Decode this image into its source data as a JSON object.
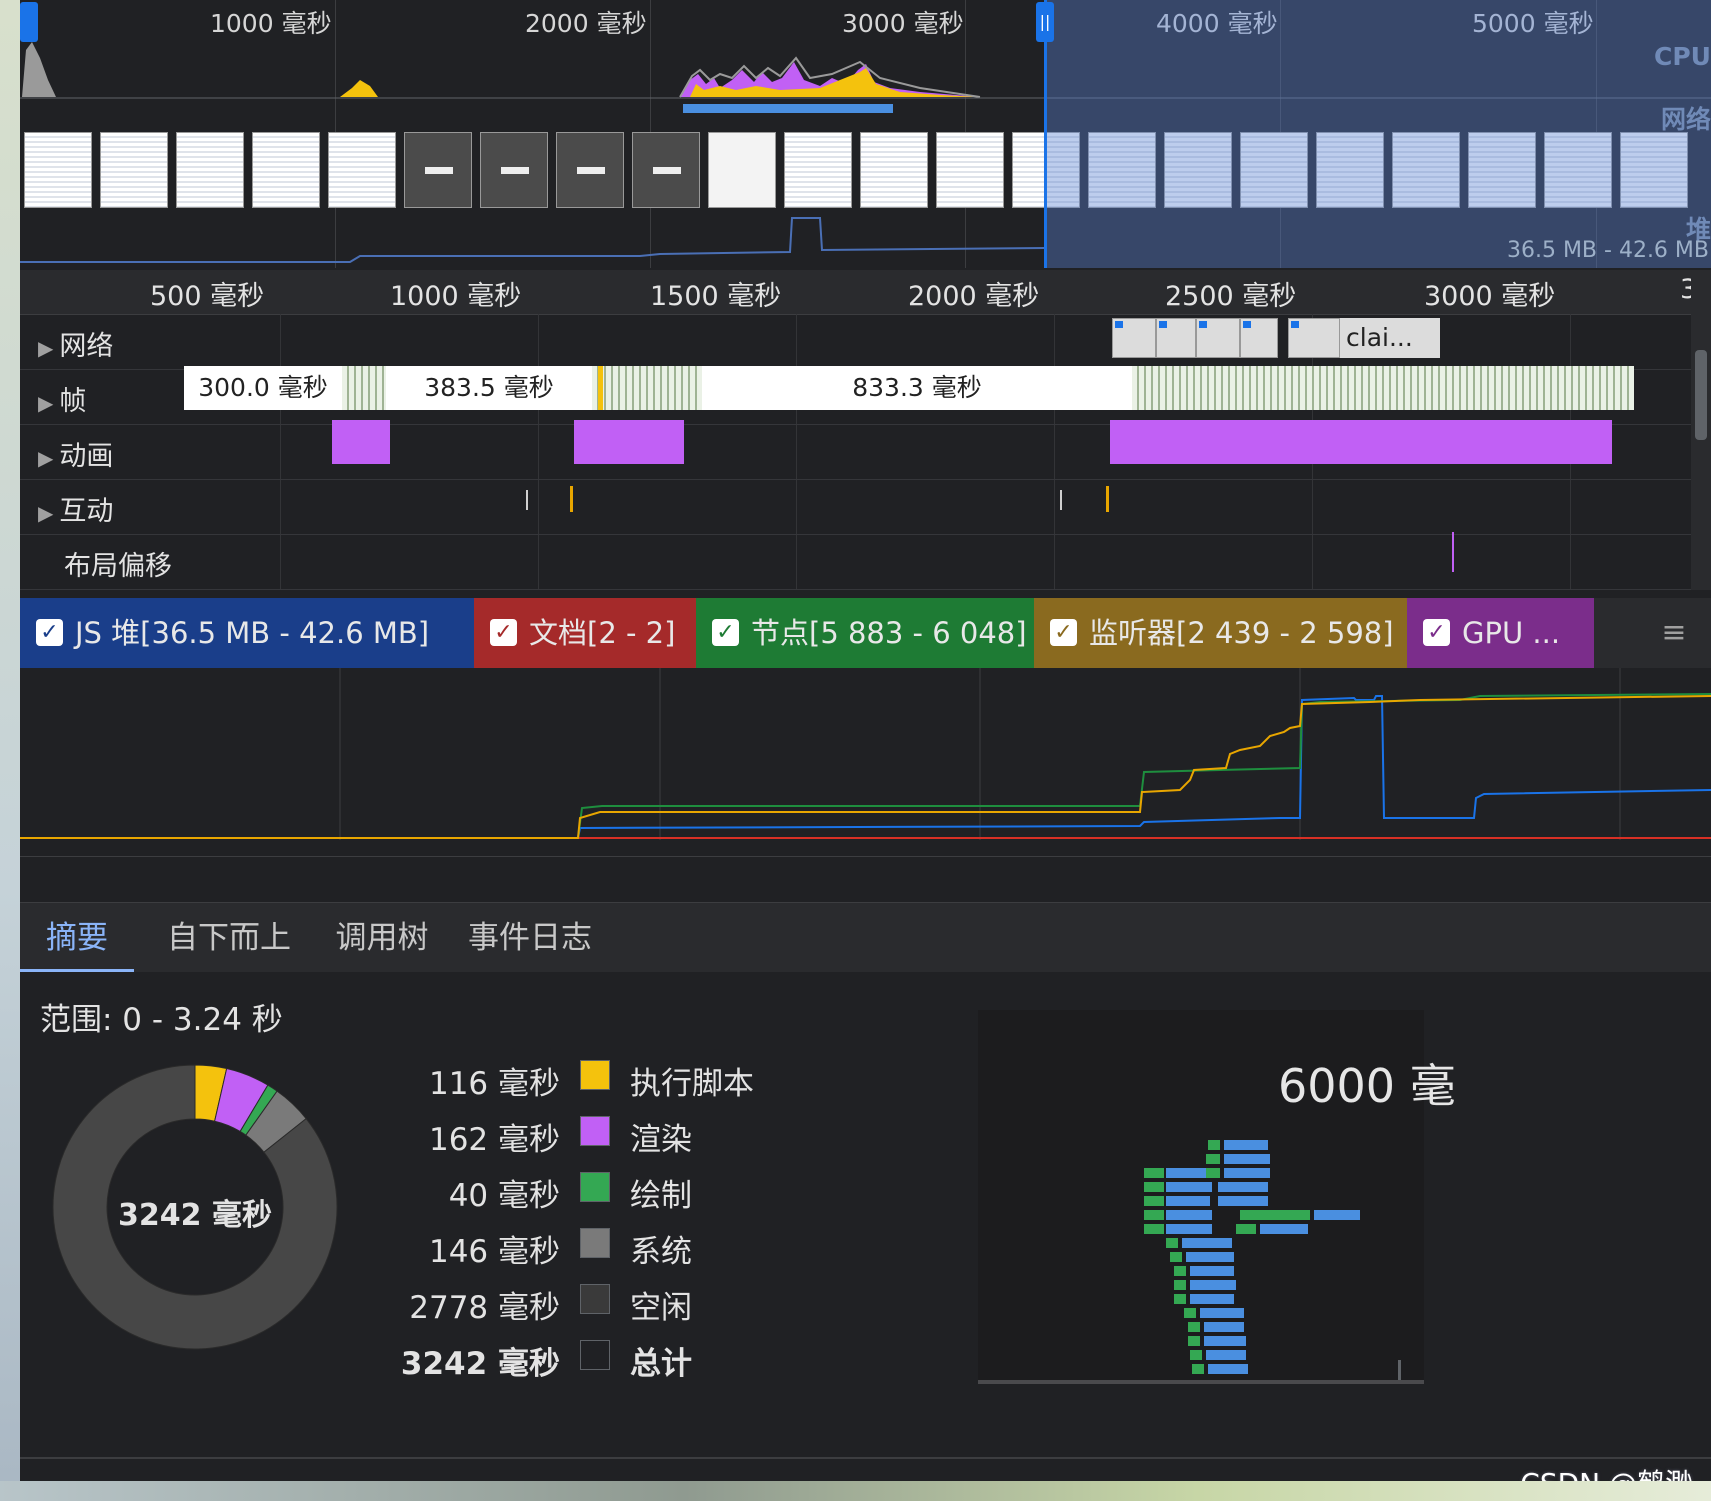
{
  "overview": {
    "tick_labels": [
      "1000 毫秒",
      "2000 毫秒",
      "3000 毫秒",
      "4000 毫秒",
      "5000 毫秒"
    ],
    "side_labels": {
      "cpu": "CPU",
      "network": "网络",
      "heap": "堆"
    },
    "heap_range": "36.5 MB - 42.6 MB",
    "handle_glyph": "||"
  },
  "ruler": {
    "labels": [
      "500 毫秒",
      "1000 毫秒",
      "1500 毫秒",
      "2000 毫秒",
      "2500 毫秒",
      "3000 毫秒",
      "3"
    ]
  },
  "tracks": {
    "network": {
      "label": "网络",
      "request_label": "clai..."
    },
    "frames": {
      "label": "帧",
      "durations": [
        "300.0 毫秒",
        "383.5 毫秒",
        "833.3 毫秒"
      ]
    },
    "animations": {
      "label": "动画"
    },
    "interactions": {
      "label": "互动"
    },
    "layout_shifts": {
      "label": "布局偏移"
    },
    "expand_glyph": "▶"
  },
  "counters": {
    "check_glyph": "✓",
    "menu_glyph": "≡",
    "items": [
      {
        "label": "JS 堆[36.5 MB - 42.6 MB]",
        "color": "#1a3e8a",
        "series_color": "#1a73e8"
      },
      {
        "label": "文档[2 - 2]",
        "color": "#a52a2a",
        "series_color": "#d93025"
      },
      {
        "label": "节点[5 883 - 6 048]",
        "color": "#1e7b34",
        "series_color": "#1e8e3e"
      },
      {
        "label": "监听器[2 439 - 2 598]",
        "color": "#8a6a1f",
        "series_color": "#e8a600"
      },
      {
        "label": "GPU ...",
        "color": "#7b2d8b",
        "series_color": "#a142f4"
      }
    ]
  },
  "tabs": [
    {
      "label": "摘要",
      "active": true
    },
    {
      "label": "自下而上",
      "active": false
    },
    {
      "label": "调用树",
      "active": false
    },
    {
      "label": "事件日志",
      "active": false
    }
  ],
  "summary": {
    "range": "范围:  0 - 3.24 秒",
    "total_center": "3242 毫秒",
    "categories": [
      {
        "value": "116 毫秒",
        "name": "执行脚本",
        "color": "#f4c20d",
        "ms": 116
      },
      {
        "value": "162 毫秒",
        "name": "渲染",
        "color": "#c160f5",
        "ms": 162
      },
      {
        "value": "40 毫秒",
        "name": "绘制",
        "color": "#34a853",
        "ms": 40
      },
      {
        "value": "146 毫秒",
        "name": "系统",
        "color": "#7a7a7a",
        "ms": 146
      },
      {
        "value": "2778 毫秒",
        "name": "空闲",
        "color": "#3a3a3a",
        "ms": 2778
      }
    ],
    "total": {
      "value": "3242 毫秒",
      "name": "总计"
    },
    "thumbnail_time": "6000 毫"
  },
  "watermark": "CSDN @鹤渺"
}
